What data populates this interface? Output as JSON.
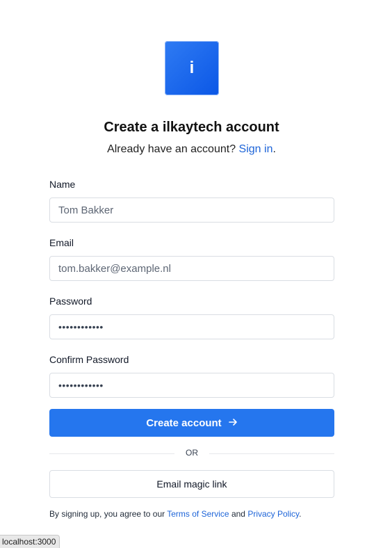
{
  "logo": {
    "letter": "i"
  },
  "heading": {
    "title": "Create a ilkaytech account",
    "subtitle_prefix": "Already have an account?",
    "signin_link": "Sign in",
    "subtitle_suffix": "."
  },
  "form": {
    "name": {
      "label": "Name",
      "value": "Tom Bakker"
    },
    "email": {
      "label": "Email",
      "value": "tom.bakker@example.nl"
    },
    "password": {
      "label": "Password",
      "value": "••••••••••••"
    },
    "confirm_password": {
      "label": "Confirm Password",
      "value": "••••••••••••"
    }
  },
  "buttons": {
    "create_account": "Create account",
    "create_account_icon": "arrow-right-icon",
    "or": "OR",
    "magic_link": "Email magic link"
  },
  "terms": {
    "prefix": "By signing up, you agree to our",
    "terms_link": "Terms of Service",
    "and": "and",
    "privacy_link": "Privacy Policy",
    "suffix": "."
  },
  "status_bar": {
    "url": "localhost:3000"
  },
  "colors": {
    "primary": "#2576ee",
    "link": "#1d64d8",
    "logo_gradient_start": "#2f7bf3",
    "logo_gradient_end": "#0b57e6"
  }
}
